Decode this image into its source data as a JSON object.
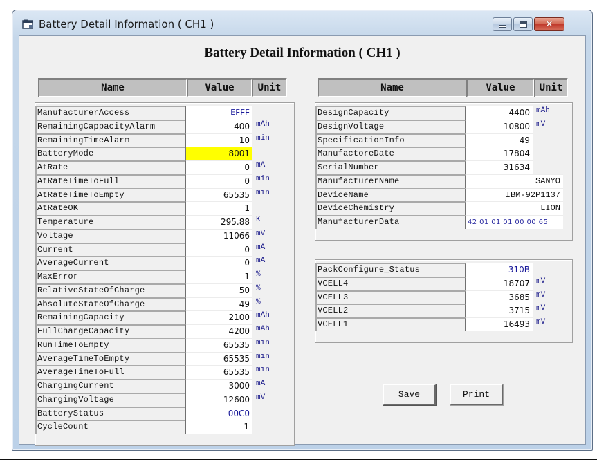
{
  "window": {
    "title": "Battery Detail Information ( CH1 )",
    "icon": "window-icon",
    "controls": {
      "minimize": "minimize-icon",
      "maximize": "maximize-icon",
      "close": "close-icon",
      "close_glyph": "✕"
    }
  },
  "main_title": "Battery Detail Information ( CH1 )",
  "headers": {
    "name": "Name",
    "value": "Value",
    "unit": "Unit"
  },
  "left_table": {
    "rows": [
      {
        "name": "ManufacturerAccess",
        "value": "EFFF",
        "unit": "",
        "kind": "hex"
      },
      {
        "name": "RemainingCappacityAlarm",
        "value": "400",
        "unit": "mAh"
      },
      {
        "name": "RemainingTimeAlarm",
        "value": "10",
        "unit": "min"
      },
      {
        "name": "BatteryMode",
        "value": "8001",
        "unit": "",
        "kind": "highlight"
      },
      {
        "name": "AtRate",
        "value": "0",
        "unit": "mA"
      },
      {
        "name": "AtRateTimeToFull",
        "value": "0",
        "unit": "min"
      },
      {
        "name": "AtRateTimeToEmpty",
        "value": "65535",
        "unit": "min"
      },
      {
        "name": "AtRateOK",
        "value": "1",
        "unit": ""
      },
      {
        "name": "Temperature",
        "value": "295.88",
        "unit": "K"
      },
      {
        "name": "Voltage",
        "value": "11066",
        "unit": "mV"
      },
      {
        "name": "Current",
        "value": "0",
        "unit": "mA"
      },
      {
        "name": "AverageCurrent",
        "value": "0",
        "unit": "mA"
      },
      {
        "name": "MaxError",
        "value": "1",
        "unit": "%"
      },
      {
        "name": "RelativeStateOfCharge",
        "value": "50",
        "unit": "%"
      },
      {
        "name": "AbsoluteStateOfCharge",
        "value": "49",
        "unit": "%"
      },
      {
        "name": "RemainingCapacity",
        "value": "2100",
        "unit": "mAh"
      },
      {
        "name": "FullChargeCapacity",
        "value": "4200",
        "unit": "mAh"
      },
      {
        "name": "RunTimeToEmpty",
        "value": "65535",
        "unit": "min"
      },
      {
        "name": "AverageTimeToEmpty",
        "value": "65535",
        "unit": "min"
      },
      {
        "name": "AverageTimeToFull",
        "value": "65535",
        "unit": "min"
      },
      {
        "name": "ChargingCurrent",
        "value": "3000",
        "unit": "mA"
      },
      {
        "name": "ChargingVoltage",
        "value": "12600",
        "unit": "mV"
      },
      {
        "name": "BatteryStatus",
        "value": "00C0",
        "unit": "",
        "kind": "hexblue"
      },
      {
        "name": "CycleCount",
        "value": "1",
        "unit": "",
        "kind": "editing"
      }
    ]
  },
  "right_table": {
    "rows": [
      {
        "name": "DesignCapacity",
        "value": "4400",
        "unit": "mAh"
      },
      {
        "name": "DesignVoltage",
        "value": "10800",
        "unit": "mV"
      },
      {
        "name": "SpecificationInfo",
        "value": "49",
        "unit": ""
      },
      {
        "name": "ManufactoreDate",
        "value": "17804",
        "unit": ""
      },
      {
        "name": "SerialNumber",
        "value": "31634",
        "unit": ""
      },
      {
        "name": "ManufacturerName",
        "value": "SANYO",
        "unit": "",
        "kind": "wide"
      },
      {
        "name": "DeviceName",
        "value": "IBM-92P1137",
        "unit": "",
        "kind": "wide"
      },
      {
        "name": "DeviceChemistry",
        "value": "LION",
        "unit": "",
        "kind": "wide"
      },
      {
        "name": "ManufacturerData",
        "value": "42 01 01 01 00 00 65",
        "unit": "",
        "kind": "bytes"
      }
    ]
  },
  "cell_table": {
    "rows": [
      {
        "name": "PackConfigure_Status",
        "value": "310B",
        "unit": "",
        "kind": "hexblue"
      },
      {
        "name": "VCELL4",
        "value": "18707",
        "unit": "mV"
      },
      {
        "name": "VCELL3",
        "value": "3685",
        "unit": "mV"
      },
      {
        "name": "VCELL2",
        "value": "3715",
        "unit": "mV"
      },
      {
        "name": "VCELL1",
        "value": "16493",
        "unit": "mV"
      }
    ]
  },
  "buttons": {
    "save": "Save",
    "print": "Print"
  },
  "colors": {
    "highlight": "#ffff00",
    "hex_value": "#1a1a9a",
    "unit_text": "#1a1a8a",
    "close_button": "#c0392b"
  }
}
